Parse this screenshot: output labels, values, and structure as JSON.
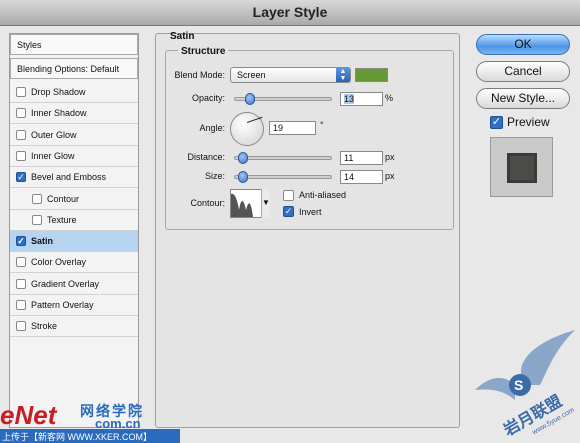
{
  "window": {
    "title": "Layer Style"
  },
  "sidebar": {
    "items": [
      {
        "label": "Styles",
        "type": "header",
        "checked": null
      },
      {
        "label": "Blending Options: Default",
        "type": "header",
        "checked": null
      },
      {
        "label": "Drop Shadow",
        "type": "item",
        "checked": false
      },
      {
        "label": "Inner Shadow",
        "type": "item",
        "checked": false
      },
      {
        "label": "Outer Glow",
        "type": "item",
        "checked": false
      },
      {
        "label": "Inner Glow",
        "type": "item",
        "checked": false
      },
      {
        "label": "Bevel and Emboss",
        "type": "item",
        "checked": true
      },
      {
        "label": "Contour",
        "type": "sub",
        "checked": false
      },
      {
        "label": "Texture",
        "type": "sub",
        "checked": false
      },
      {
        "label": "Satin",
        "type": "item",
        "checked": true,
        "selected": true
      },
      {
        "label": "Color Overlay",
        "type": "item",
        "checked": false
      },
      {
        "label": "Gradient Overlay",
        "type": "item",
        "checked": false
      },
      {
        "label": "Pattern Overlay",
        "type": "item",
        "checked": false
      },
      {
        "label": "Stroke",
        "type": "item",
        "checked": false
      }
    ]
  },
  "satin": {
    "section_title": "Satin",
    "group_title": "Structure",
    "blend_mode": {
      "label": "Blend Mode:",
      "value": "Screen",
      "color": "#669933"
    },
    "opacity": {
      "label": "Opacity:",
      "value": "13",
      "unit": "%",
      "level": 0.13
    },
    "angle": {
      "label": "Angle:",
      "value": "19",
      "unit": "°"
    },
    "distance": {
      "label": "Distance:",
      "value": "11",
      "unit": "px",
      "level": 0.04
    },
    "size": {
      "label": "Size:",
      "value": "14",
      "unit": "px",
      "level": 0.05
    },
    "contour": {
      "label": "Contour:"
    },
    "anti_aliased": {
      "label": "Anti-aliased",
      "checked": false
    },
    "invert": {
      "label": "Invert",
      "checked": true
    }
  },
  "buttons": {
    "ok": "OK",
    "cancel": "Cancel",
    "new_style": "New Style..."
  },
  "preview": {
    "label": "Preview",
    "checked": true
  },
  "watermark": {
    "left_brand": "eNet",
    "left_cn": "网络学院",
    "left_domain": "com.cn",
    "left_line": "上传于【新客网 WWW.XKER.COM】",
    "right_brand": "岩月联盟",
    "right_site": "www.5yue.com"
  }
}
